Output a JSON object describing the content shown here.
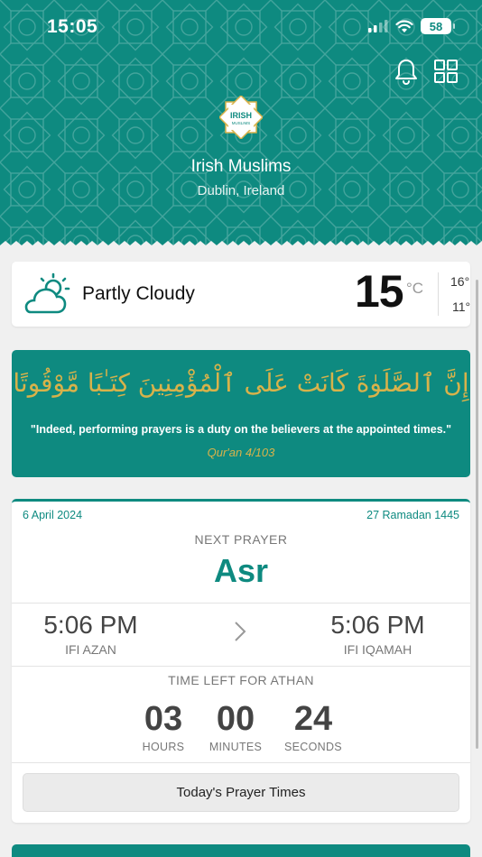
{
  "status": {
    "time": "15:05",
    "battery": "58",
    "icons": [
      "cellular-signal-icon",
      "wifi-icon",
      "battery-icon"
    ]
  },
  "header": {
    "org_name": "Irish Muslims",
    "location": "Dublin, Ireland",
    "logo_text": [
      "IRISH",
      "MUSLIMS"
    ],
    "actions": [
      "bell-icon",
      "grid-icon"
    ]
  },
  "weather": {
    "condition": "Partly Cloudy",
    "temperature": "15",
    "unit": "°C",
    "high": "16°",
    "low": "11°",
    "icon": "partly-cloudy-icon"
  },
  "verse": {
    "arabic": "إِنَّ ٱلصَّلَوٰةَ كَانَتْ عَلَى ٱلْمُؤْمِنِينَ كِتَـٰبًا مَّوْقُوتًا",
    "translation": "\"Indeed, performing prayers is a duty on the believers at the appointed times.\"",
    "reference": "Qur'an 4/103"
  },
  "prayer": {
    "date": "6 April 2024",
    "hijri": "27 Ramadan 1445",
    "next_label": "NEXT PRAYER",
    "next_name": "Asr",
    "azan_time": "5:06 PM",
    "azan_label": "IFI AZAN",
    "iqamah_time": "5:06 PM",
    "iqamah_label": "IFI IQAMAH",
    "time_left_label": "TIME LEFT FOR ATHAN",
    "hours": "03",
    "hours_label": "HOURS",
    "minutes": "00",
    "minutes_label": "MINUTES",
    "seconds": "24",
    "seconds_label": "SECONDS",
    "button": "Today's Prayer Times"
  },
  "colors": {
    "brand": "#0e8a80",
    "gold": "#d8b24a"
  }
}
